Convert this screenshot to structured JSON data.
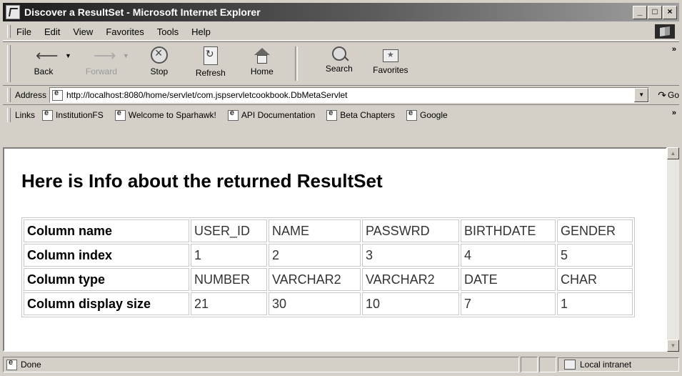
{
  "window": {
    "title": "Discover a ResultSet - Microsoft Internet Explorer",
    "min": "_",
    "max": "□",
    "close": "×"
  },
  "menu": {
    "items": [
      {
        "label": "File"
      },
      {
        "label": "Edit"
      },
      {
        "label": "View"
      },
      {
        "label": "Favorites"
      },
      {
        "label": "Tools"
      },
      {
        "label": "Help"
      }
    ]
  },
  "toolbar": {
    "back": "Back",
    "forward": "Forward",
    "stop": "Stop",
    "refresh": "Refresh",
    "home": "Home",
    "search": "Search",
    "favorites": "Favorites",
    "more": "»"
  },
  "address": {
    "label": "Address",
    "url": "http://localhost:8080/home/servlet/com.jspservletcookbook.DbMetaServlet",
    "go": "Go"
  },
  "links": {
    "label": "Links",
    "items": [
      "InstitutionFS",
      "Welcome to Sparhawk!",
      "API Documentation",
      "Beta Chapters",
      "Google"
    ],
    "more": "»"
  },
  "page": {
    "heading": "Here is Info about the returned ResultSet",
    "rows": [
      {
        "label": "Column name",
        "values": [
          "USER_ID",
          "NAME",
          "PASSWRD",
          "BIRTHDATE",
          "GENDER"
        ]
      },
      {
        "label": "Column index",
        "values": [
          "1",
          "2",
          "3",
          "4",
          "5"
        ]
      },
      {
        "label": "Column type",
        "values": [
          "NUMBER",
          "VARCHAR2",
          "VARCHAR2",
          "DATE",
          "CHAR"
        ]
      },
      {
        "label": "Column display size",
        "values": [
          "21",
          "30",
          "10",
          "7",
          "1"
        ]
      }
    ]
  },
  "status": {
    "text": "Done",
    "zone": "Local intranet"
  }
}
